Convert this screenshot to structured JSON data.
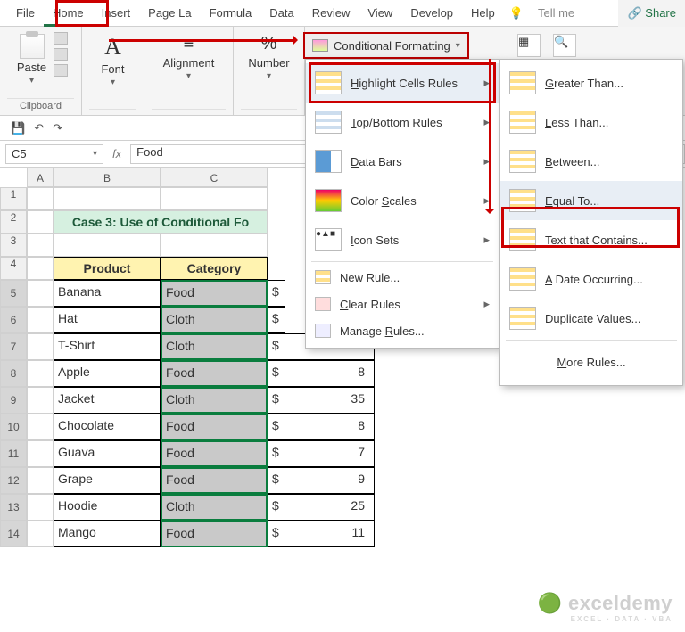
{
  "tabs": {
    "file": "File",
    "home": "Home",
    "insert": "Insert",
    "pagela": "Page La",
    "formula": "Formula",
    "data": "Data",
    "review": "Review",
    "view": "View",
    "develop": "Develop",
    "help": "Help",
    "tellme": "Tell me",
    "share": "Share"
  },
  "groups": {
    "clipboard": "Clipboard",
    "paste": "Paste",
    "font": "Font",
    "alignment": "Alignment",
    "number": "Number"
  },
  "cf_button": "Conditional Formatting",
  "menu1": {
    "highlight": "Highlight Cells Rules",
    "topbottom": "Top/Bottom Rules",
    "databars": "Data Bars",
    "colorscales": "Color Scales",
    "iconsets": "Icon Sets",
    "newrule": "New Rule...",
    "clear": "Clear Rules",
    "manage": "Manage Rules..."
  },
  "menu2": {
    "greater": "Greater Than...",
    "less": "Less Than...",
    "between": "Between...",
    "equal": "Equal To...",
    "textcont": "Text that Contains...",
    "dateocc": "A Date Occurring...",
    "dup": "Duplicate Values...",
    "more": "More Rules..."
  },
  "namebox": "C5",
  "fxvalue": "Food",
  "cols": [
    "A",
    "B",
    "C"
  ],
  "title": "Case 3: Use of Conditional Fo",
  "headers": {
    "product": "Product",
    "category": "Category"
  },
  "rows": [
    {
      "n": 5,
      "product": "Banana",
      "category": "Food",
      "price": ""
    },
    {
      "n": 6,
      "product": "Hat",
      "category": "Cloth",
      "price": ""
    },
    {
      "n": 7,
      "product": "T-Shirt",
      "category": "Cloth",
      "price": "12"
    },
    {
      "n": 8,
      "product": "Apple",
      "category": "Food",
      "price": "8"
    },
    {
      "n": 9,
      "product": "Jacket",
      "category": "Cloth",
      "price": "35"
    },
    {
      "n": 10,
      "product": "Chocolate",
      "category": "Food",
      "price": "8"
    },
    {
      "n": 11,
      "product": "Guava",
      "category": "Food",
      "price": "7"
    },
    {
      "n": 12,
      "product": "Grape",
      "category": "Food",
      "price": "9"
    },
    {
      "n": 13,
      "product": "Hoodie",
      "category": "Cloth",
      "price": "25"
    },
    {
      "n": 14,
      "product": "Mango",
      "category": "Food",
      "price": "11"
    }
  ],
  "currency": "$",
  "watermark": "exceldemy",
  "watermark_sub": "EXCEL · DATA · VBA"
}
